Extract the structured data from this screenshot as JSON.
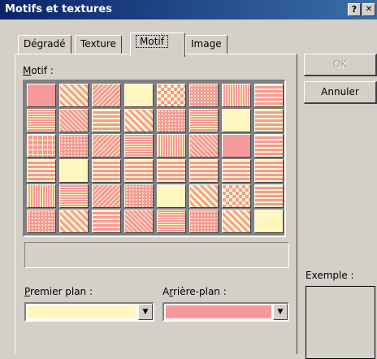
{
  "window": {
    "title": "Motifs et textures",
    "help_glyph": "?",
    "close_glyph": "✕"
  },
  "tabs": [
    {
      "label": "Dégradé",
      "active": false
    },
    {
      "label": "Texture",
      "active": false
    },
    {
      "label": "Motif",
      "active": true
    },
    {
      "label": "Image",
      "active": false
    }
  ],
  "motif": {
    "label": "Motif :",
    "pattern_colors": {
      "foreground": "#fff6c0",
      "background": "#f59a9a"
    },
    "selected_preview_text": ""
  },
  "foreground": {
    "label": "Premier plan :",
    "color": "#fff6c0"
  },
  "background": {
    "label": "Arrière-plan :",
    "color": "#f59a9a"
  },
  "buttons": {
    "ok": "OK",
    "cancel": "Annuler"
  },
  "sample": {
    "label": "Exemple :"
  },
  "icons": {
    "dropdown": "▼"
  }
}
